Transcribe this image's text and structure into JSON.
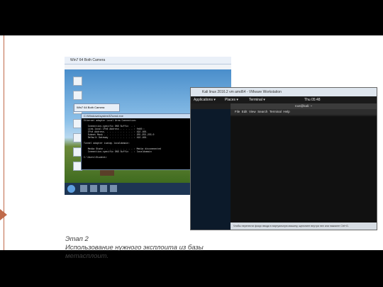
{
  "caption": {
    "line1": "Этап 2",
    "line2": "Использование нужного эксплоита из базы",
    "line3": "метасплоит."
  },
  "left_vm": {
    "title": "Win7 64 Both Camera",
    "browser_title": "Win7 64 Both Camera",
    "cmd_title": "C:\\Windows\\system32\\cmd.exe",
    "cmd_lines": [
      "Ethernet adapter Local Area Connection:",
      "",
      "   Connection-specific DNS Suffix  . : ",
      "   Link-local IPv6 Address . . . . . : fe80::",
      "   IPv4 Address. . . . . . . . . . . : 192.168.",
      "   Subnet Mask . . . . . . . . . . . : 255.255.255.0",
      "   Default Gateway . . . . . . . . . : 192.168.",
      "",
      "Tunnel adapter isatap.localdomain:",
      "",
      "   Media State . . . . . . . . . . . : Media disconnected",
      "   Connection-specific DNS Suffix  . : localdomain",
      "",
      "C:\\Users\\Student>"
    ]
  },
  "right_vm": {
    "host_title": "Kali linux 2016.2 vm amd64 - VMware Workstation",
    "topbar_apps": "Applications ▾",
    "topbar_places": "Places ▾",
    "topbar_terminal": "Terminal ▾",
    "topbar_clock": "Thu 05:48",
    "term_title": "root@kali: ~",
    "term_menu": "File  Edit  View  Search  Terminal  Help",
    "status": "Чтобы перенести фокус ввода в виртуальную машину, щелкните внутри нее или нажмите Ctrl+G."
  },
  "colors": {
    "accent": "#c06a4a",
    "caption_text": "#404040"
  }
}
